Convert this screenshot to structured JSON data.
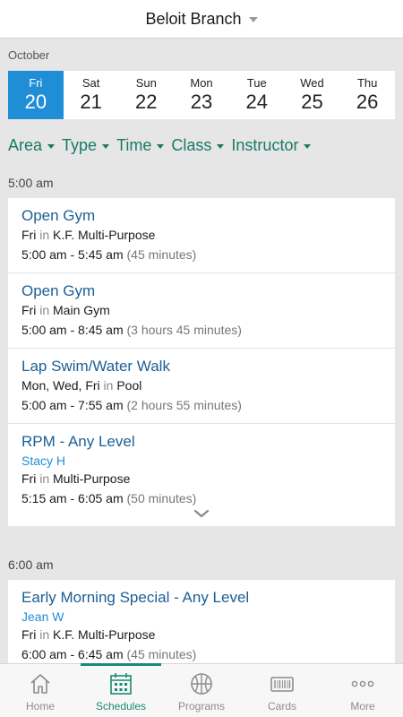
{
  "header": {
    "branch": "Beloit Branch"
  },
  "calendar": {
    "month": "October",
    "days": [
      {
        "name": "Fri",
        "num": "20",
        "active": true
      },
      {
        "name": "Sat",
        "num": "21"
      },
      {
        "name": "Sun",
        "num": "22"
      },
      {
        "name": "Mon",
        "num": "23"
      },
      {
        "name": "Tue",
        "num": "24"
      },
      {
        "name": "Wed",
        "num": "25"
      },
      {
        "name": "Thu",
        "num": "26"
      }
    ]
  },
  "filters": [
    "Area",
    "Type",
    "Time",
    "Class",
    "Instructor"
  ],
  "sections": [
    {
      "time": "5:00 am",
      "entries": [
        {
          "title": "Open Gym",
          "days": "Fri",
          "in": "in",
          "location": "K.F. Multi-Purpose",
          "range": "5:00 am - 5:45 am",
          "duration": "(45 minutes)"
        },
        {
          "title": "Open Gym",
          "days": "Fri",
          "in": "in",
          "location": "Main Gym",
          "range": "5:00 am - 8:45 am",
          "duration": "(3 hours 45 minutes)"
        },
        {
          "title": "Lap Swim/Water Walk",
          "days": "Mon, Wed, Fri",
          "in": "in",
          "location": "Pool",
          "range": "5:00 am - 7:55 am",
          "duration": "(2 hours 55 minutes)"
        },
        {
          "title": "RPM - Any Level",
          "instructor": "Stacy H",
          "days": "Fri",
          "in": "in",
          "location": "Multi-Purpose",
          "range": "5:15 am - 6:05 am",
          "duration": "(50 minutes)"
        }
      ]
    },
    {
      "time": "6:00 am",
      "entries": [
        {
          "title": "Early Morning Special - Any Level",
          "instructor": "Jean W",
          "days": "Fri",
          "in": "in",
          "location": "K.F. Multi-Purpose",
          "range": "6:00 am - 6:45 am",
          "duration": "(45 minutes)"
        }
      ]
    }
  ],
  "tabs": [
    {
      "label": "Home",
      "icon": "home-icon"
    },
    {
      "label": "Schedules",
      "icon": "calendar-icon",
      "active": true
    },
    {
      "label": "Programs",
      "icon": "basketball-icon"
    },
    {
      "label": "Cards",
      "icon": "barcode-card-icon"
    },
    {
      "label": "More",
      "icon": "more-dots-icon"
    }
  ],
  "colors": {
    "accent_blue": "#1f8ed6",
    "title_blue": "#1a5f96",
    "teal": "#187a66"
  }
}
